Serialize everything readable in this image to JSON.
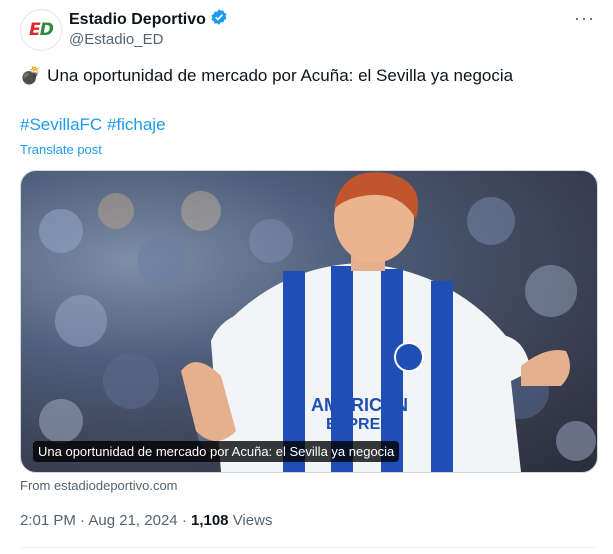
{
  "author": {
    "name": "Estadio Deportivo",
    "handle": "@Estadio_ED",
    "logo_text": "ED",
    "verified": true
  },
  "more_icon": "more-horizontal-icon",
  "tweet": {
    "emoji": "💣",
    "text": "Una oportunidad de mercado por Acuña: el Sevilla ya negocia",
    "hashtags": [
      "#SevillaFC",
      "#fichaje"
    ],
    "translate_label": "Translate post"
  },
  "card": {
    "caption": "Una oportunidad de mercado por Acuña: el Sevilla ya negocia",
    "from_label": "From estadiodeportivo.com",
    "image_alt": "Football player in blue and white striped kit",
    "sponsor_text": "AMERICAN EXPRESS"
  },
  "meta": {
    "time": "2:01 PM",
    "date": "Aug 21, 2024",
    "views_count": "1,108",
    "views_label": "Views",
    "separator": "·"
  },
  "colors": {
    "link": "#1d9bf0",
    "secondary_text": "#536471",
    "primary_text": "#0f1419",
    "verified": "#1d9bf0"
  }
}
